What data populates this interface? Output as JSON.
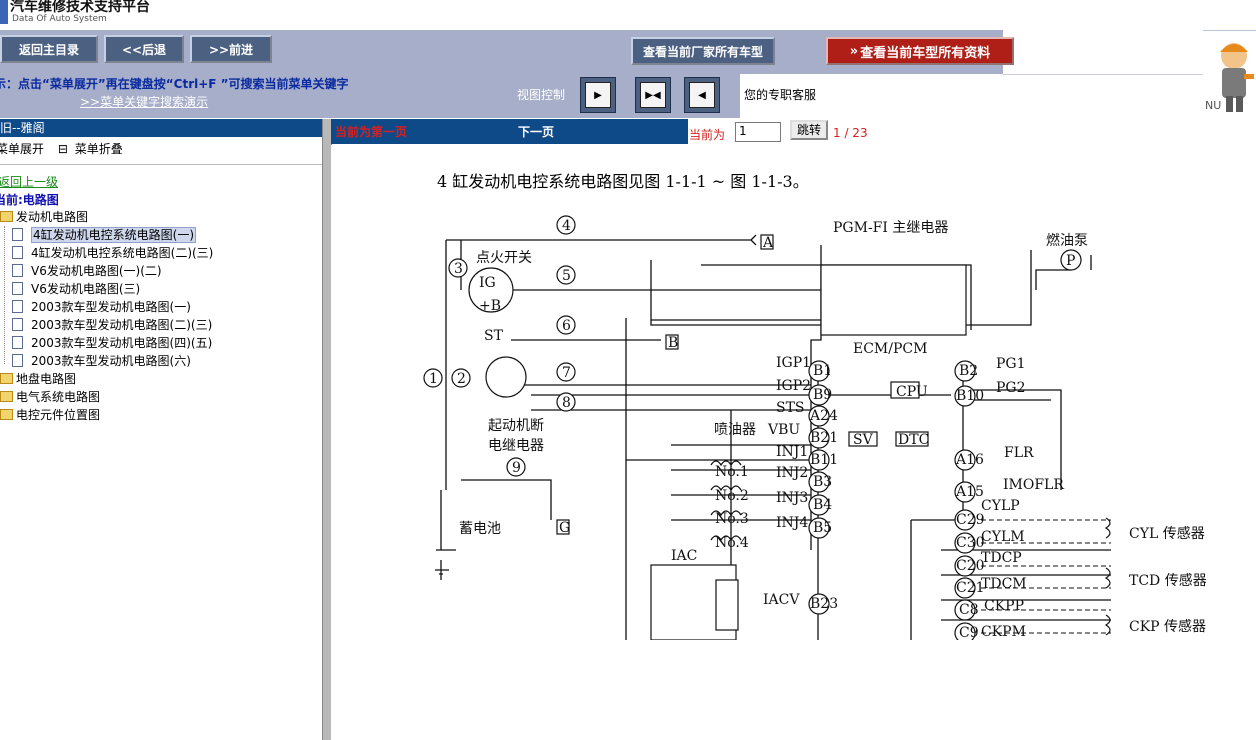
{
  "app": {
    "title": "汽车维修技术支持平台",
    "subtitle": "Data Of Auto System"
  },
  "nav": {
    "home": "返回主目录",
    "back": "<<后退",
    "forward": ">>前进",
    "all_models": "查看当前厂家所有车型",
    "all_data": "查看当前车型所有资料"
  },
  "hint": {
    "text": "示：点击“菜单展开”再在键盘按“Ctrl+F ”可搜索当前菜单关键字",
    "link": ">>菜单关键字搜索演示",
    "view_control": "视图控制",
    "service": "您的专职客服",
    "nu": "NU"
  },
  "sidebar": {
    "header": "旧--雅阁",
    "expand": "菜单展开",
    "collapse": "菜单折叠",
    "back": "返回上一级",
    "current": "当前:电路图",
    "folders": [
      "发动机电路图",
      "地盘电路图",
      "电气系统电路图",
      "电控元件位置图"
    ],
    "items": [
      "4缸发动机电控系统电路图(一)",
      "4缸发动机电控系统电路图(二)(三)",
      "V6发动机电路图(一)(二)",
      "V6发动机电路图(三)",
      "2003款车型发动机电路图(一)",
      "2003款车型发动机电路图(二)(三)",
      "2003款车型发动机电路图(四)(五)",
      "2003款车型发动机电路图(六)"
    ]
  },
  "pager": {
    "prev": "当前为第一页",
    "next": "下一页",
    "current_label": "当前为",
    "page_value": "1",
    "go": "跳转",
    "count": "1 / 23"
  },
  "diagram": {
    "title": "4 缸发动机电控系统电路图见图 1-1-1 ~ 图 1-1-3。",
    "labels": {
      "pgm": "PGM-FI 主继电器",
      "fuel_pump": "燃油泵",
      "p": "P",
      "ign": "点火开关",
      "ig": "IG",
      "b": "+B",
      "st": "ST",
      "ecm": "ECM/PCM",
      "igp1": "IGP1",
      "igp2": "IGP2",
      "sts": "STS",
      "vbu": "VBU",
      "inj1": "INJ1",
      "inj2": "INJ2",
      "inj3": "INJ3",
      "inj4": "INJ4",
      "iacv": "IACV",
      "iac": "IAC",
      "pg1": "PG1",
      "pg2": "PG2",
      "flr": "FLR",
      "imoflr": "IMOFLR",
      "cylp": "CYLP",
      "cylm": "CYLM",
      "tdcp": "TDCP",
      "tdcm": "TDCM",
      "ckpp": "CKPP",
      "ckpm": "CKPM",
      "cyl_sensor": "CYL 传感器",
      "tcd_sensor": "TCD 传感器",
      "ckp_sensor": "CKP 传感器",
      "cpu": "CPU",
      "sv": "SV",
      "dtc": "DTC",
      "injector": "喷油器",
      "starter_relay_1": "起动机断",
      "starter_relay_2": "电继电器",
      "battery": "蓄电池",
      "no1": "No.1",
      "no2": "No.2",
      "no3": "No.3",
      "no4": "No.4",
      "pin_b1": "B1",
      "pin_b9": "B9",
      "pin_a24": "A24",
      "pin_b21": "B21",
      "pin_b11": "B11",
      "pin_b3": "B3",
      "pin_b4": "B4",
      "pin_b5": "B5",
      "pin_b23": "B23",
      "pin_b2": "B2",
      "pin_b10": "B10",
      "pin_a16": "A16",
      "pin_a15": "A15",
      "pin_c29": "C29",
      "pin_c30": "C30",
      "pin_c20": "C20",
      "pin_c21": "C21",
      "pin_c8": "C8",
      "pin_c9": "C9",
      "fuse_1": "1",
      "fuse_2": "2",
      "fuse_3": "3",
      "fuse_4": "4",
      "fuse_5": "5",
      "fuse_6": "6",
      "fuse_7": "7",
      "fuse_8": "8",
      "fuse_9": "9",
      "conn_a": "A",
      "conn_b": "B",
      "conn_g": "G"
    }
  },
  "colors": {
    "nav_bg": "#a7aec9",
    "button_bg": "#4c6082",
    "header_blue": "#0f4a88",
    "accent_red": "#b01e18"
  }
}
